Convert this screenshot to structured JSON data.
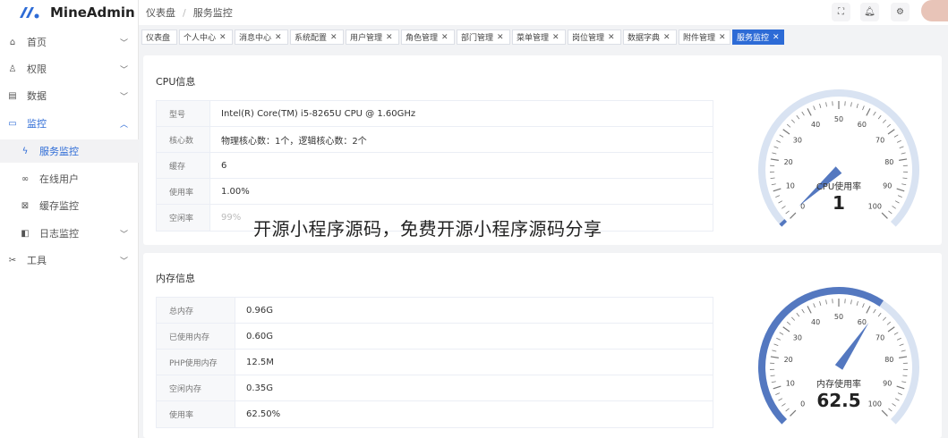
{
  "app": {
    "name": "MineAdmin"
  },
  "breadcrumb": [
    "仪表盘",
    "服务监控"
  ],
  "colors": {
    "accent": "#2d6bd6",
    "gauge_track": "#d9e3f2",
    "gauge_fill": "#5478c0"
  },
  "sidebar": {
    "items": [
      {
        "label": "首页",
        "icon": "home-icon",
        "glyph": "⌂",
        "expandable": true
      },
      {
        "label": "权限",
        "icon": "user-icon",
        "glyph": "♙",
        "expandable": true
      },
      {
        "label": "数据",
        "icon": "database-icon",
        "glyph": "▤",
        "expandable": true
      },
      {
        "label": "监控",
        "icon": "monitor-icon",
        "glyph": "▭",
        "expandable": true,
        "open": true
      },
      {
        "label": "服务监控",
        "icon": "flash-icon",
        "glyph": "ϟ",
        "sub": true,
        "active": true
      },
      {
        "label": "在线用户",
        "icon": "link-icon",
        "glyph": "∞",
        "sub": true
      },
      {
        "label": "缓存监控",
        "icon": "cache-icon",
        "glyph": "⊠",
        "sub": true
      },
      {
        "label": "日志监控",
        "icon": "book-icon",
        "glyph": "◧",
        "sub": true,
        "expandable": true
      },
      {
        "label": "工具",
        "icon": "tool-icon",
        "glyph": "✂",
        "expandable": true
      }
    ]
  },
  "tabs": [
    {
      "label": "仪表盘",
      "closable": false
    },
    {
      "label": "个人中心",
      "closable": true
    },
    {
      "label": "消息中心",
      "closable": true
    },
    {
      "label": "系统配置",
      "closable": true
    },
    {
      "label": "用户管理",
      "closable": true
    },
    {
      "label": "角色管理",
      "closable": true
    },
    {
      "label": "部门管理",
      "closable": true
    },
    {
      "label": "菜单管理",
      "closable": true
    },
    {
      "label": "岗位管理",
      "closable": true
    },
    {
      "label": "数据字典",
      "closable": true
    },
    {
      "label": "附件管理",
      "closable": true
    },
    {
      "label": "服务监控",
      "closable": true,
      "active": true
    }
  ],
  "cpu": {
    "title": "CPU信息",
    "rows": [
      {
        "key": "型号",
        "value": "Intel(R) Core(TM) i5-8265U CPU @ 1.60GHz"
      },
      {
        "key": "核心数",
        "value": "物理核心数：1个，逻辑核心数：2个"
      },
      {
        "key": "缓存",
        "value": "6"
      },
      {
        "key": "使用率",
        "value": "1.00%"
      },
      {
        "key": "空闲率",
        "value": "99%"
      }
    ],
    "gauge": {
      "label": "CPU使用率",
      "value": 1,
      "display": "1",
      "min": 0,
      "max": 100,
      "ticks": [
        "0",
        "10",
        "20",
        "30",
        "40",
        "50",
        "60",
        "70",
        "80",
        "90",
        "100"
      ]
    }
  },
  "memory": {
    "title": "内存信息",
    "rows": [
      {
        "key": "总内存",
        "value": "0.96G"
      },
      {
        "key": "已使用内存",
        "value": "0.60G"
      },
      {
        "key": "PHP使用内存",
        "value": "12.5M"
      },
      {
        "key": "空闲内存",
        "value": "0.35G"
      },
      {
        "key": "使用率",
        "value": "62.50%"
      }
    ],
    "gauge": {
      "label": "内存使用率",
      "value": 62.5,
      "display": "62.5",
      "min": 0,
      "max": 100,
      "ticks": [
        "0",
        "10",
        "20",
        "30",
        "40",
        "50",
        "60",
        "70",
        "80",
        "90",
        "100"
      ]
    }
  },
  "watermark": "开源小程序源码，免费开源小程序源码分享"
}
